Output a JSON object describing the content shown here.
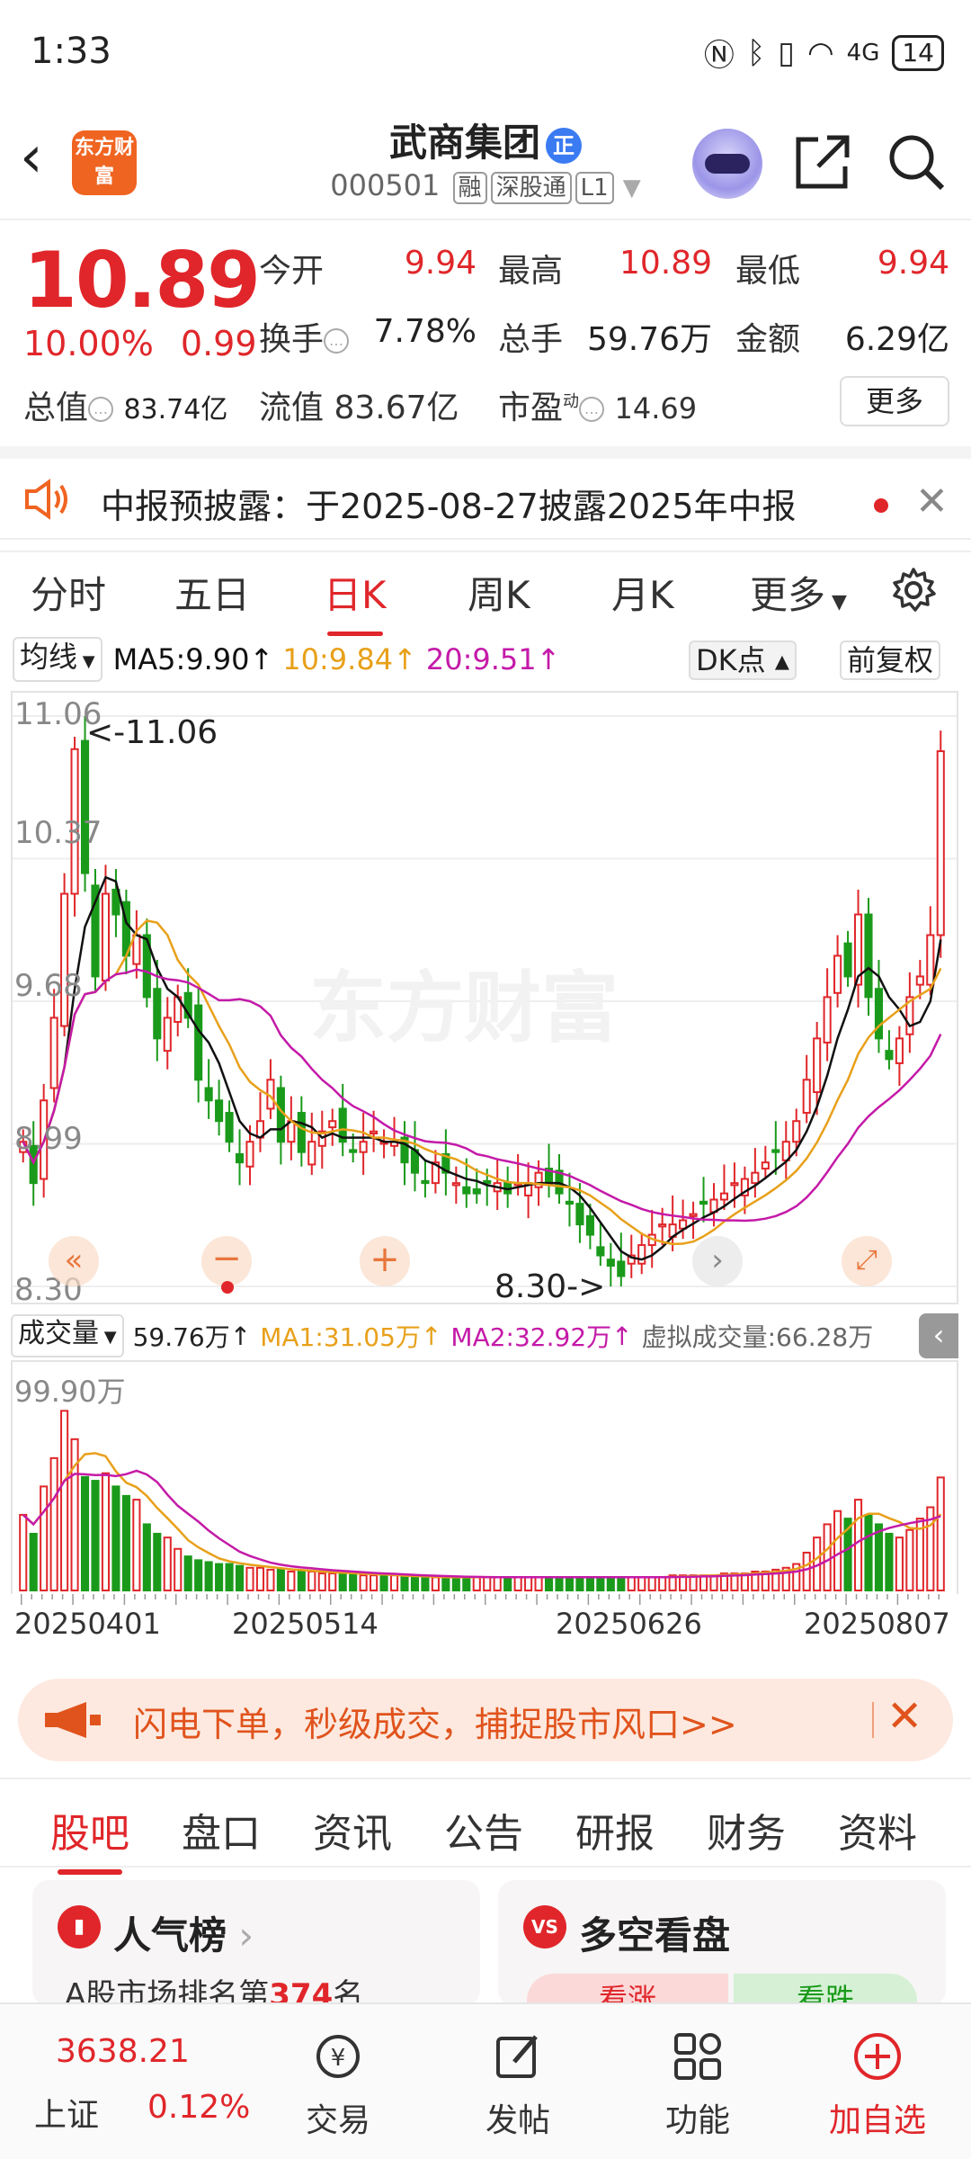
{
  "status": {
    "time": "1:33",
    "battery": "14",
    "network": "4G"
  },
  "header": {
    "title": "武商集团",
    "title_badge": "正",
    "code": "000501",
    "tags": [
      "融",
      "深股通",
      "L1"
    ],
    "logo_text": "东方财富"
  },
  "quote": {
    "price": "10.89",
    "change_pct": "10.00%",
    "change_amt": "0.99",
    "open_label": "今开",
    "open": "9.94",
    "high_label": "最高",
    "high": "10.89",
    "low_label": "最低",
    "low": "9.94",
    "turnover_label": "换手",
    "turnover": "7.78%",
    "volume_label": "总手",
    "volume": "59.76万",
    "amount_label": "金额",
    "amount": "6.29亿",
    "mktcap_label": "总值",
    "mktcap": "83.74亿",
    "float_label": "流值",
    "float": "83.67亿",
    "pe_label": "市盈",
    "pe_sup": "动",
    "pe": "14.69",
    "more_label": "更多"
  },
  "notice": {
    "text": "中报预披露：于2025-08-27披露2025年中报"
  },
  "ktabs": {
    "t1": "分时",
    "t2": "五日",
    "t3": "日K",
    "t4": "周K",
    "t5": "月K",
    "t6": "更多",
    "active": "日K"
  },
  "ma": {
    "selector": "均线",
    "ma5": "MA5:9.90",
    "ma10": "10:9.84",
    "ma20": "20:9.51",
    "dk": "DK点",
    "adj": "前复权"
  },
  "chart_labels": {
    "y1": "11.06",
    "y2": "10.37",
    "y3": "9.68",
    "y4": "8.99",
    "y5": "8.30",
    "max_mark": "<-11.06",
    "min_mark": "8.30->",
    "watermark": "东方财富"
  },
  "volume": {
    "selector": "成交量",
    "vol": "59.76万",
    "ma1": "MA1:31.05万",
    "ma2": "MA2:32.92万",
    "virtual": "虚拟成交量:66.28万",
    "ymax": "99.90万"
  },
  "dates": [
    "20250401",
    "20250514",
    "20250626",
    "20250807"
  ],
  "banner": {
    "text": "闪电下单，秒级成交，捕捉股市风口>>"
  },
  "btabs": {
    "t1": "股吧",
    "t2": "盘口",
    "t3": "资讯",
    "t4": "公告",
    "t5": "研报",
    "t6": "财务",
    "t7": "资料"
  },
  "cards": {
    "left_title": "人气榜",
    "left_sub_prefix": "A股市场排名第",
    "left_rank": "374",
    "left_sub_suffix": "名",
    "right_title": "多空看盘",
    "right_up": "看涨",
    "right_down": "看跌"
  },
  "nav": {
    "index_value": "3638.21",
    "index_name": "上证",
    "index_change": "0.12%",
    "trade": "交易",
    "post": "发帖",
    "func": "功能",
    "add": "加自选"
  },
  "colors": {
    "up": "#e0262a",
    "down": "#1a9a1a",
    "ma5": "#111111",
    "ma10": "#e8a01a",
    "ma20": "#c41aa8",
    "accent": "#f06421"
  },
  "chart_data": {
    "type": "candlestick",
    "ylim": [
      8.3,
      11.06
    ],
    "y_ticks": [
      11.06,
      10.37,
      9.68,
      8.99,
      8.3
    ],
    "x_ticks": [
      "20250401",
      "20250514",
      "20250626",
      "20250807"
    ],
    "close": [
      9.0,
      8.8,
      9.2,
      9.6,
      10.2,
      10.9,
      10.3,
      9.8,
      10.2,
      10.1,
      9.9,
      10.0,
      9.7,
      9.5,
      9.6,
      9.7,
      9.6,
      9.3,
      9.2,
      9.1,
      9.0,
      8.9,
      9.0,
      9.1,
      9.3,
      9.0,
      9.1,
      8.95,
      9.0,
      9.05,
      9.1,
      9.0,
      8.95,
      9.0,
      9.05,
      9.0,
      9.0,
      8.9,
      8.85,
      8.8,
      8.9,
      8.85,
      8.8,
      8.75,
      8.75,
      8.8,
      8.8,
      8.75,
      8.8,
      8.8,
      8.85,
      8.8,
      8.75,
      8.7,
      8.6,
      8.55,
      8.45,
      8.4,
      8.35,
      8.45,
      8.5,
      8.55,
      8.6,
      8.6,
      8.62,
      8.65,
      8.7,
      8.72,
      8.75,
      8.8,
      8.82,
      8.85,
      8.9,
      8.95,
      9.0,
      9.1,
      9.3,
      9.5,
      9.7,
      9.9,
      9.8,
      10.1,
      9.7,
      9.5,
      9.4,
      9.5,
      9.7,
      9.8,
      10.0,
      10.89
    ],
    "volume_wan": [
      40,
      30,
      55,
      70,
      95,
      80,
      60,
      58,
      62,
      55,
      50,
      48,
      35,
      30,
      28,
      22,
      18,
      16,
      15,
      14,
      14,
      13,
      12,
      12,
      11,
      11,
      10,
      10,
      10,
      9,
      9,
      9,
      9,
      8,
      8,
      8,
      8,
      7,
      7,
      7,
      7,
      7,
      7,
      7,
      7,
      7,
      7,
      7,
      7,
      7,
      7,
      7,
      7,
      7,
      7,
      7,
      7,
      7,
      7,
      7,
      7,
      7,
      7,
      8,
      8,
      8,
      8,
      8,
      9,
      9,
      9,
      10,
      10,
      11,
      12,
      14,
      20,
      28,
      35,
      42,
      38,
      48,
      40,
      35,
      30,
      28,
      32,
      38,
      44,
      59.76
    ],
    "series": [
      {
        "name": "MA5",
        "last": 9.9
      },
      {
        "name": "MA10",
        "last": 9.84
      },
      {
        "name": "MA20",
        "last": 9.51
      }
    ]
  }
}
